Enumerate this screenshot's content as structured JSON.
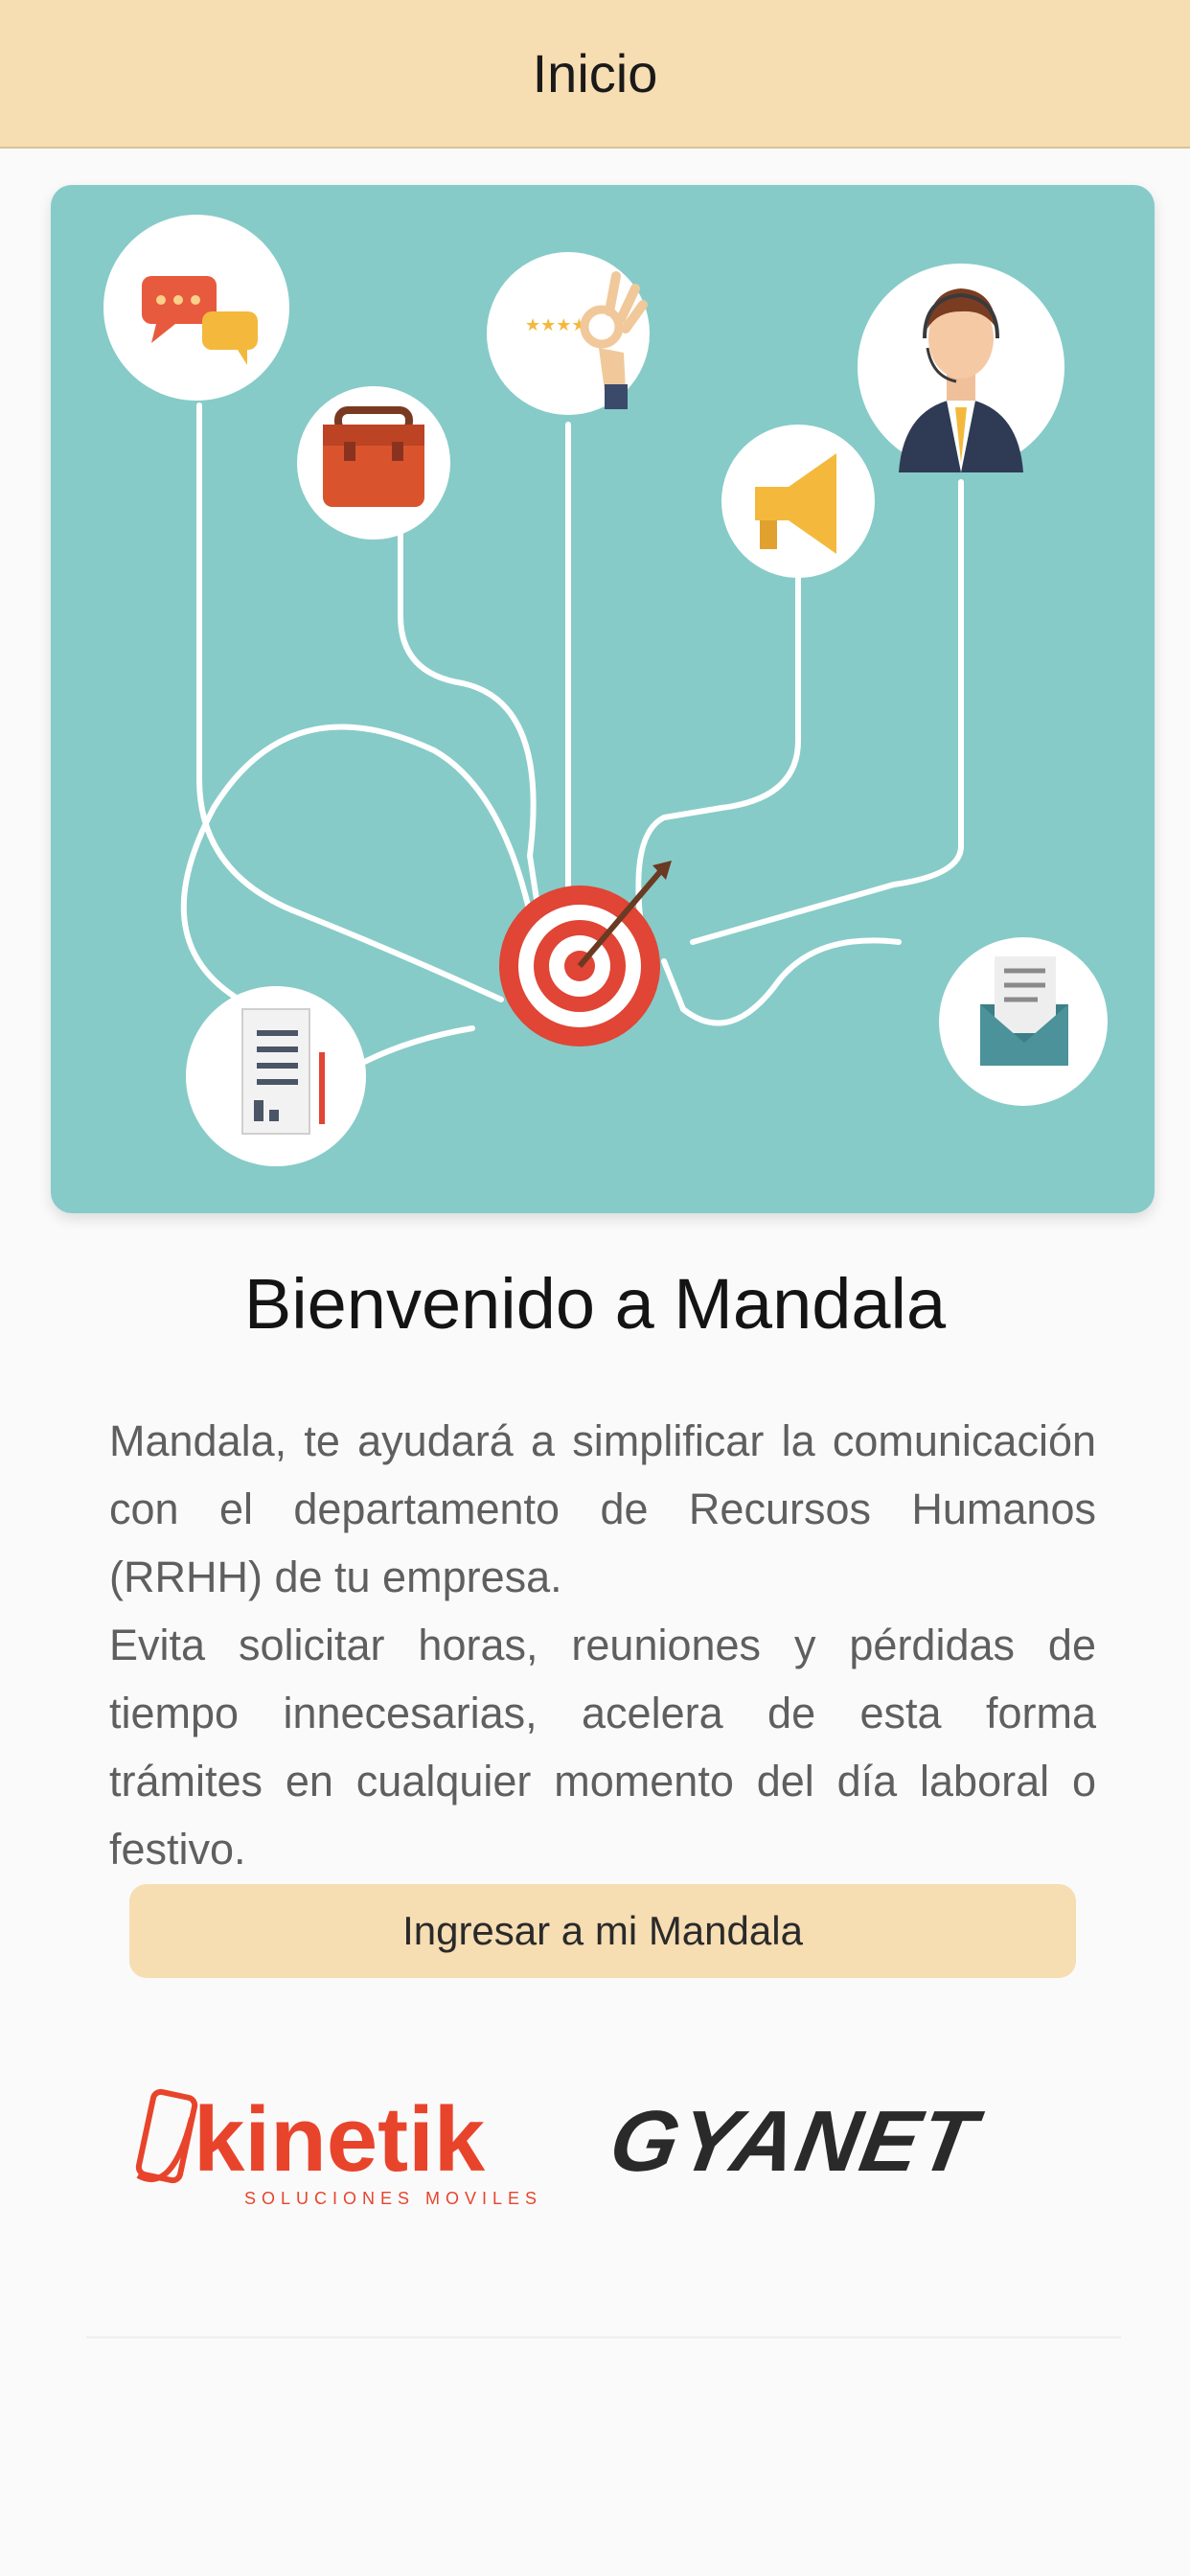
{
  "header": {
    "title": "Inicio"
  },
  "hero": {
    "colors": {
      "background": "#86cbc8",
      "target_red": "#e04535"
    },
    "icons": [
      "chat-bubbles-icon",
      "briefcase-icon",
      "rating-stars-ok-hand-icon",
      "support-agent-icon",
      "megaphone-icon",
      "target-arrow-icon",
      "document-icon",
      "envelope-icon"
    ]
  },
  "welcome": {
    "title": "Bienvenido a Mandala"
  },
  "description": {
    "paragraph1": "Mandala, te ayudará a simplificar la comunicación con el departamento de Recursos Humanos (RRHH) de tu empresa.",
    "paragraph2": "Evita solicitar horas, reuniones y pérdidas de tiempo innecesarias, acelera de esta forma trámites en cualquier momento del día laboral o festivo."
  },
  "actions": {
    "enter_label": "Ingresar a mi Mandala",
    "accent": "#f6ddb2"
  },
  "logos": {
    "kinetik": {
      "name": "kinetik",
      "tagline": "SOLUCIONES MOVILES",
      "color": "#e8442c"
    },
    "gyanet": {
      "name": "GYANET",
      "color": "#2a2a2a"
    }
  }
}
